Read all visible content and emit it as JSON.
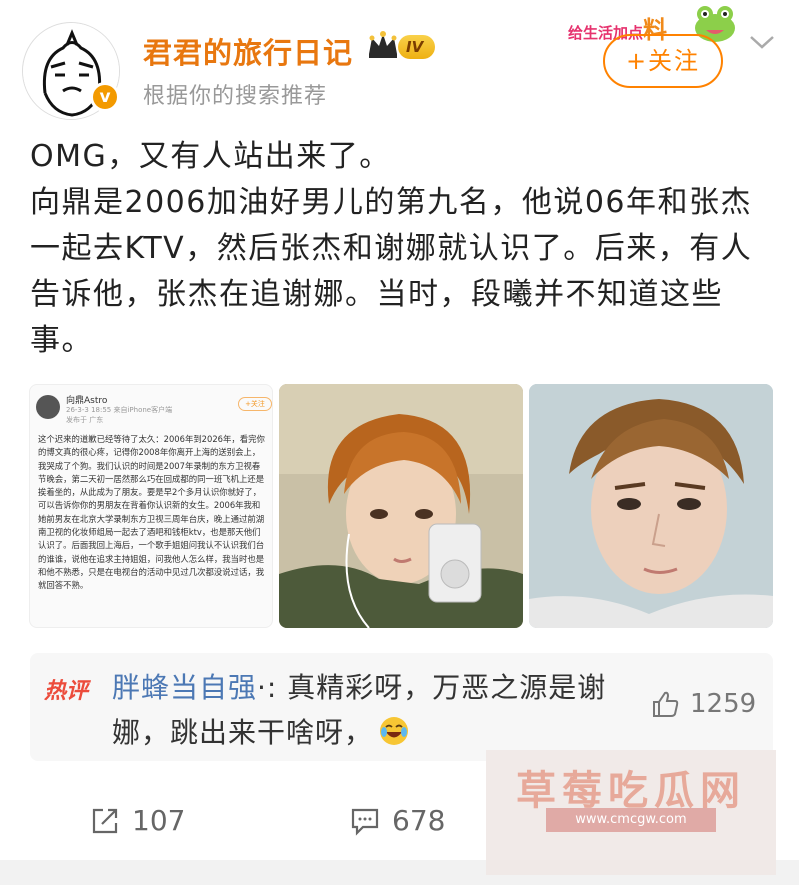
{
  "post": {
    "username": "君君的旅行日记",
    "level_badge": "IV",
    "subline": "根据你的搜索推荐",
    "verified_mark": "v",
    "follow_label": "+关注",
    "sticker_text": "给生活加点",
    "sticker_big": "料",
    "content_lines": [
      "OMG，又有人站出来了。",
      "向鼎是2006加油好男儿的第九名，他说06年和张杰一起去KTV，然后张杰和谢娜就认识了。后来，有人告诉他，张杰在追谢娜。当时，段曦并不知道这些事。"
    ]
  },
  "screenshot_card": {
    "name": "向鼎Astro",
    "meta": "26-3-3 18:55  来自iPhone客户端",
    "location": "发布于 广东",
    "follow": "+关注",
    "body": "这个迟来的道歉已经等待了太久：2006年到2026年，看完你的博文真的很心疼，记得你2008年你离开上海的送别会上，我哭成了个狗。我们认识的时间是2007年录制的东方卫视春节晚会，第二天初一居然那么巧在回成都的同一班飞机上还是挨着坐的，从此成为了朋友。要是早2个多月认识你就好了，可以告诉你你的男朋友在背着你认识新的女生。2006年我和她前男友在北京大学录制东方卫视三周年台庆，晚上通过前湖南卫视的化妆师组局一起去了酒吧和钱柜ktv，也是那天他们认识了。后面我回上海后，一个歌手姐姐问我认不认识我们台的谁谁，说他在追求主持姐姐，问我他人怎么样，我当时也是和他不熟悉，只是在电视台的活动中见过几次都没说过话，我就回答不熟。"
  },
  "hot_comment": {
    "tag": "热评",
    "user": "胖蜂当自强",
    "sep": "·:",
    "text": "真精彩呀，万恶之源是谢娜，跳出来干啥呀，",
    "likes": "1259"
  },
  "actions": {
    "reposts": "107",
    "comments": "678"
  },
  "watermark": {
    "title": "草莓吃瓜网",
    "url": "www.cmcgw.com"
  },
  "colors": {
    "accent_orange": "#ff8200",
    "username": "#e8770f",
    "link_blue": "#4c78b4",
    "hot_red": "#ec4c3c"
  },
  "icons": [
    "avatar-cartoon",
    "crown-icon",
    "chevron-down-icon",
    "thumbs-up-icon",
    "repost-icon",
    "comment-icon",
    "laugh-cry-emoji"
  ]
}
